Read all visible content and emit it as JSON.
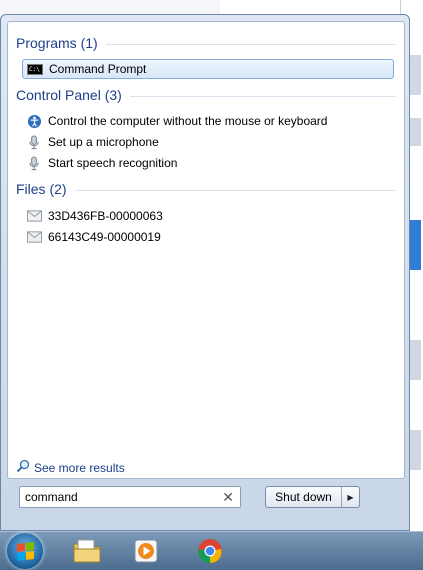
{
  "groups": {
    "programs": {
      "header": "Programs (1)",
      "items": [
        "Command Prompt"
      ]
    },
    "control_panel": {
      "header": "Control Panel (3)",
      "items": [
        "Control the computer without the mouse or keyboard",
        "Set up a microphone",
        "Start speech recognition"
      ]
    },
    "files": {
      "header": "Files (2)",
      "items": [
        "33D436FB-00000063",
        "66143C49-00000019"
      ]
    }
  },
  "see_more": "See more results",
  "search": {
    "value": "command"
  },
  "shutdown": {
    "label": "Shut down"
  },
  "taskbar": {
    "items": [
      "start-orb",
      "file-explorer-icon",
      "media-player-icon",
      "chrome-icon"
    ]
  },
  "colors": {
    "header_text": "#1e3f8a",
    "selection_border": "#84acdd"
  }
}
